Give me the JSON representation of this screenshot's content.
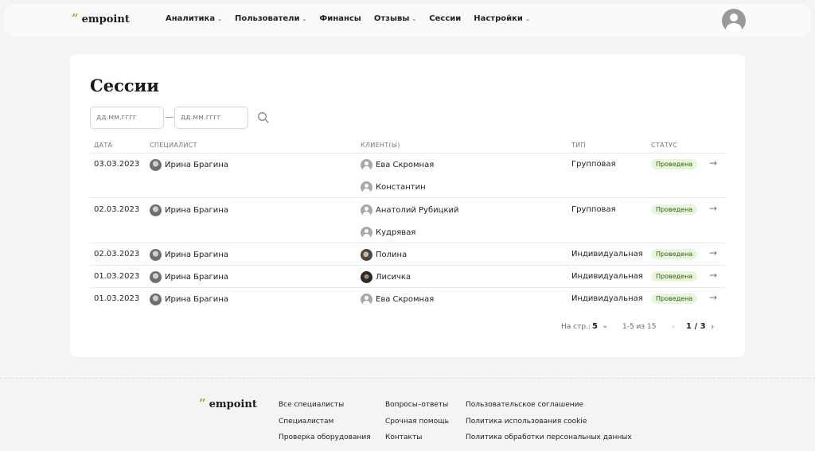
{
  "brand": {
    "name": "empoint",
    "mark": "”"
  },
  "nav": {
    "items": [
      {
        "label": "Аналитика",
        "has_dropdown": true
      },
      {
        "label": "Пользователи",
        "has_dropdown": true
      },
      {
        "label": "Финансы",
        "has_dropdown": false
      },
      {
        "label": "Отзывы",
        "has_dropdown": true
      },
      {
        "label": "Сессии",
        "has_dropdown": false
      },
      {
        "label": "Настройки",
        "has_dropdown": true
      }
    ]
  },
  "page": {
    "title": "Сессии"
  },
  "filters": {
    "date_from_placeholder": "дд.мм.гггг",
    "date_to_placeholder": "дд.мм.гггг",
    "separator": "—"
  },
  "table": {
    "headers": {
      "date": "ДАТА",
      "specialist": "СПЕЦИАЛИСТ",
      "clients": "КЛИЕНТ(Ы)",
      "type": "ТИП",
      "status": "СТАТУС"
    },
    "rows": [
      {
        "date": "03.03.2023",
        "specialist": "Ирина Брагина",
        "clients": [
          "Ева Скромная",
          "Константин"
        ],
        "type": "Групповая",
        "status": "Проведена"
      },
      {
        "date": "02.03.2023",
        "specialist": "Ирина Брагина",
        "clients": [
          "Анатолий Рубицкий",
          "Кудрявая"
        ],
        "type": "Групповая",
        "status": "Проведена"
      },
      {
        "date": "02.03.2023",
        "specialist": "Ирина Брагина",
        "clients": [
          "Полина"
        ],
        "type": "Индивидуальная",
        "status": "Проведена"
      },
      {
        "date": "01.03.2023",
        "specialist": "Ирина Брагина",
        "clients": [
          "Лисичка"
        ],
        "type": "Индивидуальная",
        "status": "Проведена"
      },
      {
        "date": "01.03.2023",
        "specialist": "Ирина Брагина",
        "clients": [
          "Ева Скромная"
        ],
        "type": "Индивидуальная",
        "status": "Проведена"
      }
    ]
  },
  "pagination": {
    "per_page_label": "На стр.:",
    "per_page_value": "5",
    "range": "1-5 из 15",
    "page": "1 / 3"
  },
  "footer": {
    "col1": [
      "Все специалисты",
      "Специалистам",
      "Проверка оборудования"
    ],
    "col2": [
      "Вопросы–ответы",
      "Срочная помощь",
      "Контакты"
    ],
    "col3": [
      "Пользовательское соглашение",
      "Политика использования cookie",
      "Политика обработки персональных данных"
    ]
  },
  "colors": {
    "accent": "#7cbd2e",
    "badge_bg": "#e8f6dc",
    "badge_text": "#2f5e12"
  }
}
